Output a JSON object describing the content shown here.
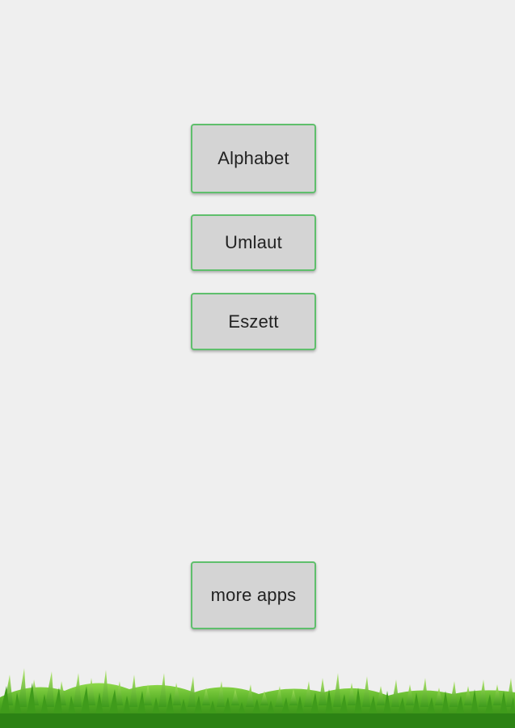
{
  "menu": {
    "alphabet_label": "Alphabet",
    "umlaut_label": "Umlaut",
    "eszett_label": "Eszett"
  },
  "footer": {
    "more_apps_label": "more apps"
  },
  "colors": {
    "background": "#efefef",
    "button_fill": "#d4d4d4",
    "button_border": "#5fbf6c",
    "button_text": "#222222",
    "grass_dark": "#2f8a16",
    "grass_light": "#7cd13a"
  },
  "decoration": {
    "footer_image": "grass-illustration"
  }
}
